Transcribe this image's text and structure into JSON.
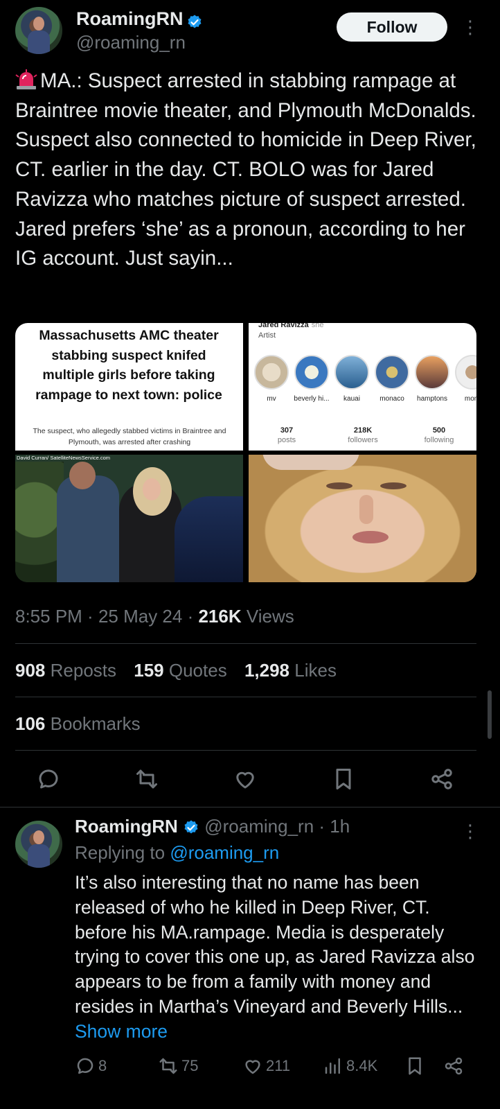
{
  "tweet": {
    "author_name": "RoamingRN",
    "author_handle": "@roaming_rn",
    "follow_label": "Follow",
    "text": "MA.: Suspect arrested in stabbing rampage at Braintree movie theater, and Plymouth McDonalds. Suspect also connected to homicide in Deep River, CT. earlier in the day. CT. BOLO was for Jared Ravizza who matches picture of suspect arrested. Jared prefers ‘she’ as a pronoun, according to her IG account. Just sayin...",
    "media": {
      "news_headline": "Massachusetts AMC theater stabbing suspect knifed multiple girls before taking rampage to next town: police",
      "news_subtext": "The suspect, who allegedly stabbed victims in Braintree and Plymouth, was arrested after crashing",
      "photo_credit": "David Curran/ SatelliteNewsService.com",
      "ig_profile": {
        "name": "Jared Ravizza",
        "pronoun": "she",
        "role": "Artist",
        "highlights": [
          "mv",
          "beverly hi...",
          "kauai",
          "monaco",
          "hamptons",
          "mont"
        ],
        "stats": [
          {
            "value": "307",
            "label": "posts"
          },
          {
            "value": "218K",
            "label": "followers"
          },
          {
            "value": "500",
            "label": "following"
          }
        ]
      }
    },
    "time": "8:55 PM",
    "date": "25 May 24",
    "views_count": "216K",
    "views_label": "Views",
    "reposts_count": "908",
    "reposts_label": "Reposts",
    "quotes_count": "159",
    "quotes_label": "Quotes",
    "likes_count": "1,298",
    "likes_label": "Likes",
    "bookmarks_count": "106",
    "bookmarks_label": "Bookmarks"
  },
  "reply": {
    "author_name": "RoamingRN",
    "author_handle": "@roaming_rn",
    "age": "1h",
    "replying_to_prefix": "Replying to",
    "replying_to_handle": "@roaming_rn",
    "text": "It’s also interesting that no name has been released of who he killed in Deep River, CT. before his MA.rampage.  Media is desperately trying to cover this one up, as Jared Ravizza also appears to be from a family with money and resides in Martha’s Vineyard and Beverly Hills...",
    "show_more_label": "Show more",
    "replies_count": "8",
    "reposts_count": "75",
    "likes_count": "211",
    "views_count": "8.4K"
  },
  "colors": {
    "background": "#000000",
    "text": "#e7e9ea",
    "muted": "#71767b",
    "accent": "#1d9bf0",
    "divider": "#2f3336"
  }
}
